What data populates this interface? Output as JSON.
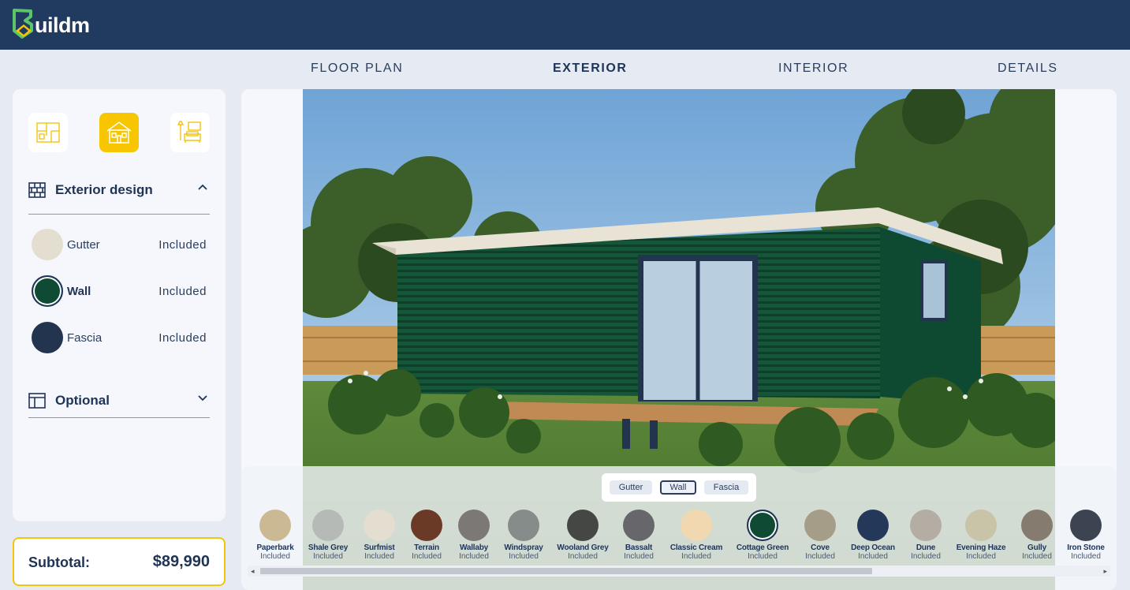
{
  "brand": {
    "name": "uildm",
    "accent": "#f7c600",
    "header_bg": "#213a60"
  },
  "tabs": [
    {
      "label": "FLOOR PLAN",
      "active": false
    },
    {
      "label": "EXTERIOR",
      "active": true
    },
    {
      "label": "INTERIOR",
      "active": false
    },
    {
      "label": "DETAILS",
      "active": false
    }
  ],
  "sidebar": {
    "step_icons": [
      "floor-plan-icon",
      "house-exterior-icon",
      "interior-living-icon"
    ],
    "exterior_section": {
      "title": "Exterior design",
      "icon": "brick-wall-icon",
      "expanded": true,
      "options": [
        {
          "label": "Gutter",
          "price": "Included",
          "color": "#e3ded0",
          "selected": false
        },
        {
          "label": "Wall",
          "price": "Included",
          "color": "#0f4a35",
          "selected": true
        },
        {
          "label": "Fascia",
          "price": "Included",
          "color": "#22344e",
          "selected": false
        }
      ]
    },
    "optional_section": {
      "title": "Optional",
      "icon": "layout-icon",
      "expanded": false
    }
  },
  "subtotal": {
    "label": "Subtotal:",
    "amount": "$89,990"
  },
  "part_switch": [
    "Gutter",
    "Wall",
    "Fascia"
  ],
  "part_switch_active": "Wall",
  "colors": [
    {
      "name": "Paperbark",
      "price": "Included",
      "hex": "#cbb994"
    },
    {
      "name": "Shale Grey",
      "price": "Included",
      "hex": "#b5bab7"
    },
    {
      "name": "Surfmist",
      "price": "Included",
      "hex": "#e3ded0"
    },
    {
      "name": "Terrain",
      "price": "Included",
      "hex": "#6b3a26"
    },
    {
      "name": "Wallaby",
      "price": "Included",
      "hex": "#7b7876"
    },
    {
      "name": "Windspray",
      "price": "Included",
      "hex": "#868c8a"
    },
    {
      "name": "Wooland Grey",
      "price": "Included",
      "hex": "#454744"
    },
    {
      "name": "Bassalt",
      "price": "Included",
      "hex": "#67676b"
    },
    {
      "name": "Classic Cream",
      "price": "Included",
      "hex": "#f2d8b0"
    },
    {
      "name": "Cottage Green",
      "price": "Included",
      "hex": "#0f4a35",
      "selected": true
    },
    {
      "name": "Cove",
      "price": "Included",
      "hex": "#a69d89"
    },
    {
      "name": "Deep Ocean",
      "price": "Included",
      "hex": "#24385a"
    },
    {
      "name": "Dune",
      "price": "Included",
      "hex": "#b3ada4"
    },
    {
      "name": "Evening Haze",
      "price": "Included",
      "hex": "#c9c3a7"
    },
    {
      "name": "Gully",
      "price": "Included",
      "hex": "#857b6e"
    },
    {
      "name": "Iron Stone",
      "price": "Included",
      "hex": "#3c4452"
    }
  ]
}
